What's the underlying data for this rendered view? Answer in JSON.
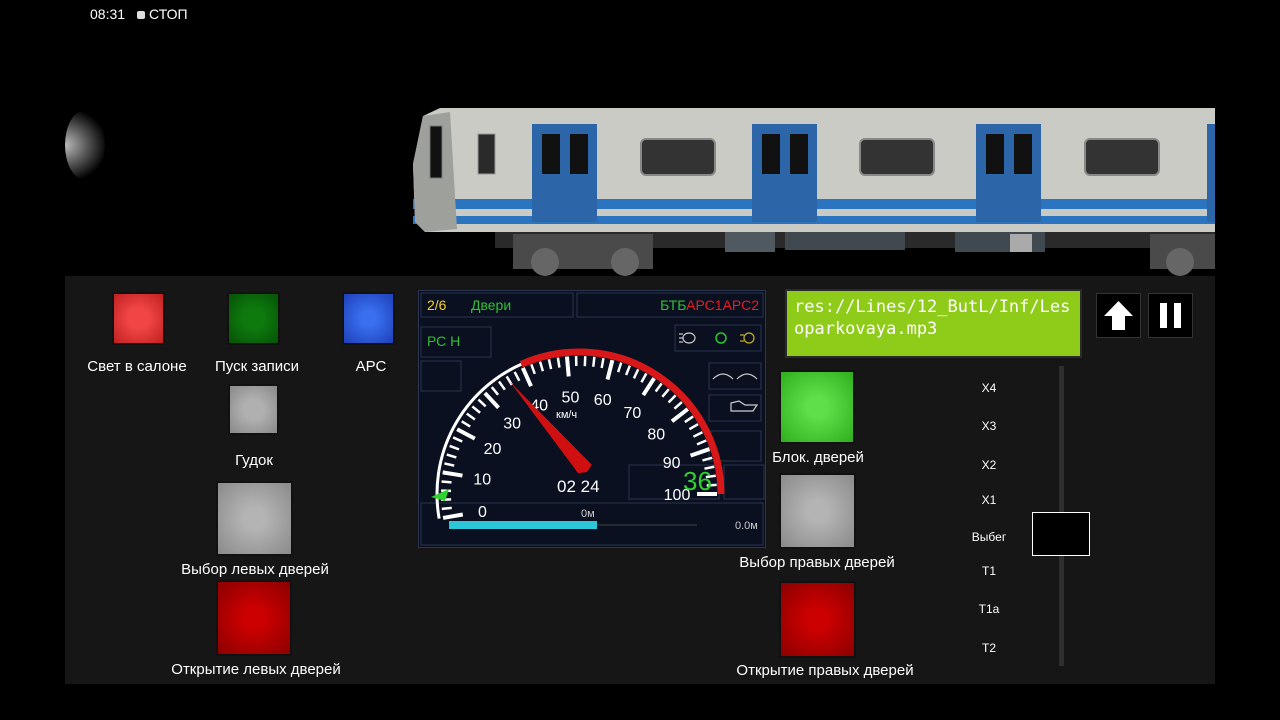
{
  "status": {
    "time": "08:31",
    "state": "СТОП"
  },
  "dashboard": {
    "counter": "2/6",
    "doors_label": "Двери",
    "btb_label": "БТБ",
    "ars_label": "АРС1АРС2",
    "rs_label": "РС Н",
    "unit_label": "км/ч",
    "clock": "02 24",
    "speed_value": "36",
    "distance_mid": "0м",
    "distance_end": "0.0м",
    "needle_speed": 36,
    "dial_ticks": [
      "0",
      "10",
      "20",
      "30",
      "40",
      "50",
      "60",
      "70",
      "80",
      "90",
      "100"
    ]
  },
  "buttons": {
    "salon_light": "Свет в салоне",
    "record_start": "Пуск записи",
    "ars": "АРС",
    "horn": "Гудок",
    "left_doors_select": "Выбор левых дверей",
    "left_doors_open": "Открытие левых дверей",
    "door_block": "Блок. дверей",
    "right_doors_select": "Выбор правых дверей",
    "right_doors_open": "Открытие правых дверей"
  },
  "info_screen": {
    "text": "res://Lines/12_ButL/Inf/Lesoparkovaya.mp3"
  },
  "controller": {
    "positions": [
      "Х4",
      "Х3",
      "Х2",
      "Х1",
      "Выбег",
      "Т1",
      "Т1а",
      "Т2"
    ],
    "selected": "Выбег"
  },
  "colors": {
    "red": "#e03030",
    "green": "#0a6a0a",
    "blue": "#2a55d8",
    "screen": "#8fcc1a"
  }
}
